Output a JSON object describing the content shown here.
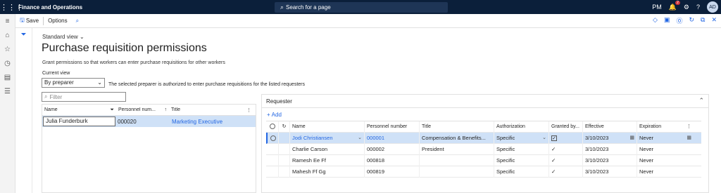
{
  "app": {
    "name": "Finance and Operations",
    "search_placeholder": "Search for a page",
    "company": "PM",
    "notification_count": "2",
    "user_initials": "AD"
  },
  "actions": {
    "save": "Save",
    "options": "Options"
  },
  "page": {
    "view_name": "Standard view",
    "title": "Purchase requisition permissions",
    "description": "Grant permissions so that workers can enter purchase requisitions for other workers",
    "current_view_label": "Current view",
    "current_view_value": "By preparer",
    "current_view_note": "The selected preparer is authorized to enter purchase requisitions for the listed requesters",
    "filter_placeholder": "Filter"
  },
  "preparers": {
    "columns": [
      "Name",
      "Personnel num...",
      "Title"
    ],
    "rows": [
      {
        "name": "Julia Funderburk",
        "personnel": "000020",
        "title": "Marketing Executive"
      }
    ]
  },
  "requester": {
    "header": "Requester",
    "add_label": "Add",
    "columns": [
      "Name",
      "Personnel number",
      "Title",
      "Authorization",
      "Granted by...",
      "Effective",
      "Expiration"
    ],
    "rows": [
      {
        "name": "Jodi Christiansen",
        "personnel": "000001",
        "title": "Compensation & Benefits...",
        "authorization": "Specific",
        "granted": true,
        "effective": "3/10/2023",
        "expiration": "Never"
      },
      {
        "name": "Charlie Carson",
        "personnel": "000002",
        "title": "President",
        "authorization": "Specific",
        "granted": true,
        "effective": "3/10/2023",
        "expiration": "Never"
      },
      {
        "name": "Ramesh Ee Ff",
        "personnel": "000818",
        "title": "",
        "authorization": "Specific",
        "granted": true,
        "effective": "3/10/2023",
        "expiration": "Never"
      },
      {
        "name": "Mahesh Ff Gg",
        "personnel": "000819",
        "title": "",
        "authorization": "Specific",
        "granted": true,
        "effective": "3/10/2023",
        "expiration": "Never"
      }
    ]
  }
}
